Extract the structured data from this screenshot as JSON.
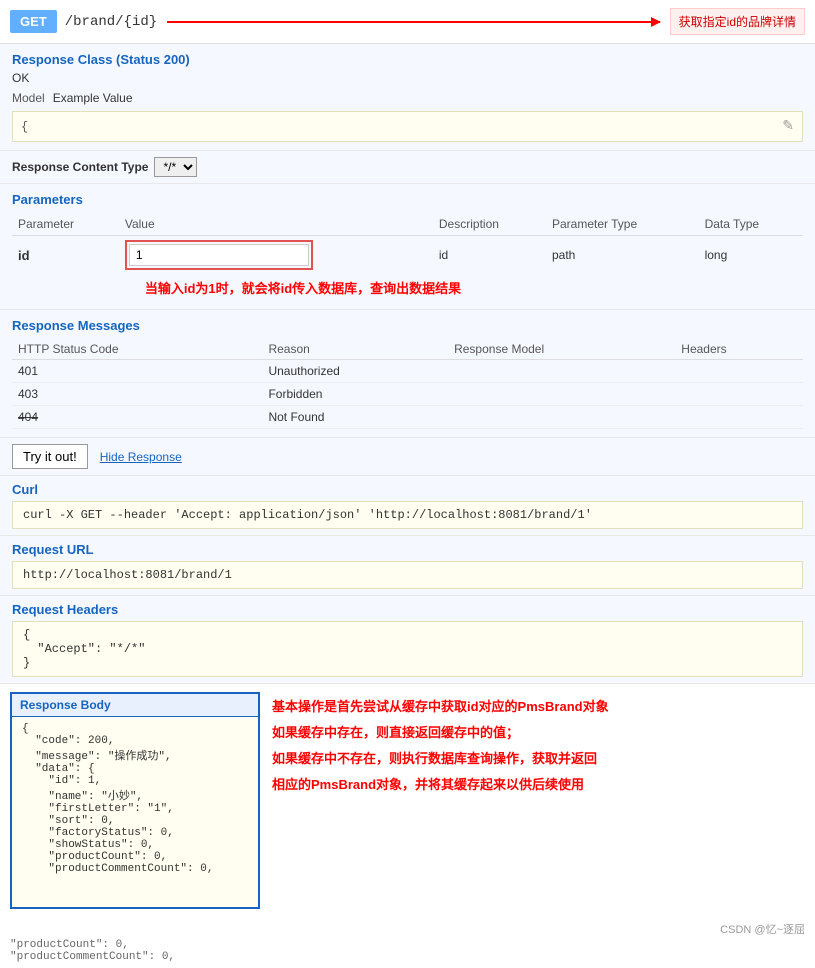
{
  "topBar": {
    "method": "GET",
    "path": "/brand/{id}",
    "arrowDesc": "获取指定id的品牌详情"
  },
  "responseClass": {
    "title": "Response Class (Status 200)",
    "status": "OK",
    "modelLabel": "Model",
    "exampleValue": "Example Value",
    "codeSnippet": "{",
    "editIcon": "✎"
  },
  "contentType": {
    "label": "Response Content Type",
    "value": "*/*"
  },
  "parameters": {
    "title": "Parameters",
    "columns": {
      "parameter": "Parameter",
      "value": "Value",
      "description": "Description",
      "parameterType": "Parameter Type",
      "dataType": "Data Type"
    },
    "rows": [
      {
        "parameter": "id",
        "value": "1",
        "description": "id",
        "parameterType": "path",
        "dataType": "long"
      }
    ],
    "annotation": "当输入id为1时，就会将id传入数据库，查询出数据结果"
  },
  "responseMessages": {
    "title": "Response Messages",
    "columns": {
      "httpStatusCode": "HTTP Status Code",
      "reason": "Reason",
      "responseModel": "Response Model",
      "headers": "Headers"
    },
    "rows": [
      {
        "code": "401",
        "reason": "Unauthorized",
        "responseModel": "",
        "headers": "",
        "strikethrough": false
      },
      {
        "code": "403",
        "reason": "Forbidden",
        "responseModel": "",
        "headers": "",
        "strikethrough": false
      },
      {
        "code": "404",
        "reason": "Not Found",
        "responseModel": "",
        "headers": "",
        "strikethrough": true
      }
    ]
  },
  "tryIt": {
    "buttonLabel": "Try it out!",
    "hideResponseLabel": "Hide Response"
  },
  "curl": {
    "title": "Curl",
    "command": "curl -X GET --header 'Accept: application/json' 'http://localhost:8081/brand/1'"
  },
  "requestUrl": {
    "title": "Request URL",
    "url": "http://localhost:8081/brand/1"
  },
  "requestHeaders": {
    "title": "Request Headers",
    "content": "{\n  \"Accept\": \"*/*\"\n}"
  },
  "responseBody": {
    "title": "Response Body",
    "content": "{\n  \"code\": 200,\n  \"message\": \"操作成功\",\n  \"data\": {\n    \"id\": 1,\n    \"name\": \"小妙\",\n    \"firstLetter\": \"1\",\n    \"sort\": 0,\n    \"factoryStatus\": 0,\n    \"showStatus\": 0,\n    \"productCount\": 0,\n    \"productCommentCount\": 0,"
  },
  "annotation": {
    "line1": "基本操作是首先尝试从缓存中获取id对应的PmsBrand对象",
    "line2": "如果缓存中存在，则直接返回缓存中的值；",
    "line3": "如果缓存中不存在，则执行数据库查询操作，获取并返回",
    "line4": "相应的PmsBrand对象，并将其缓存起来以供后续使用"
  },
  "csdn": {
    "watermark": "CSDN @忆~逐屈"
  }
}
